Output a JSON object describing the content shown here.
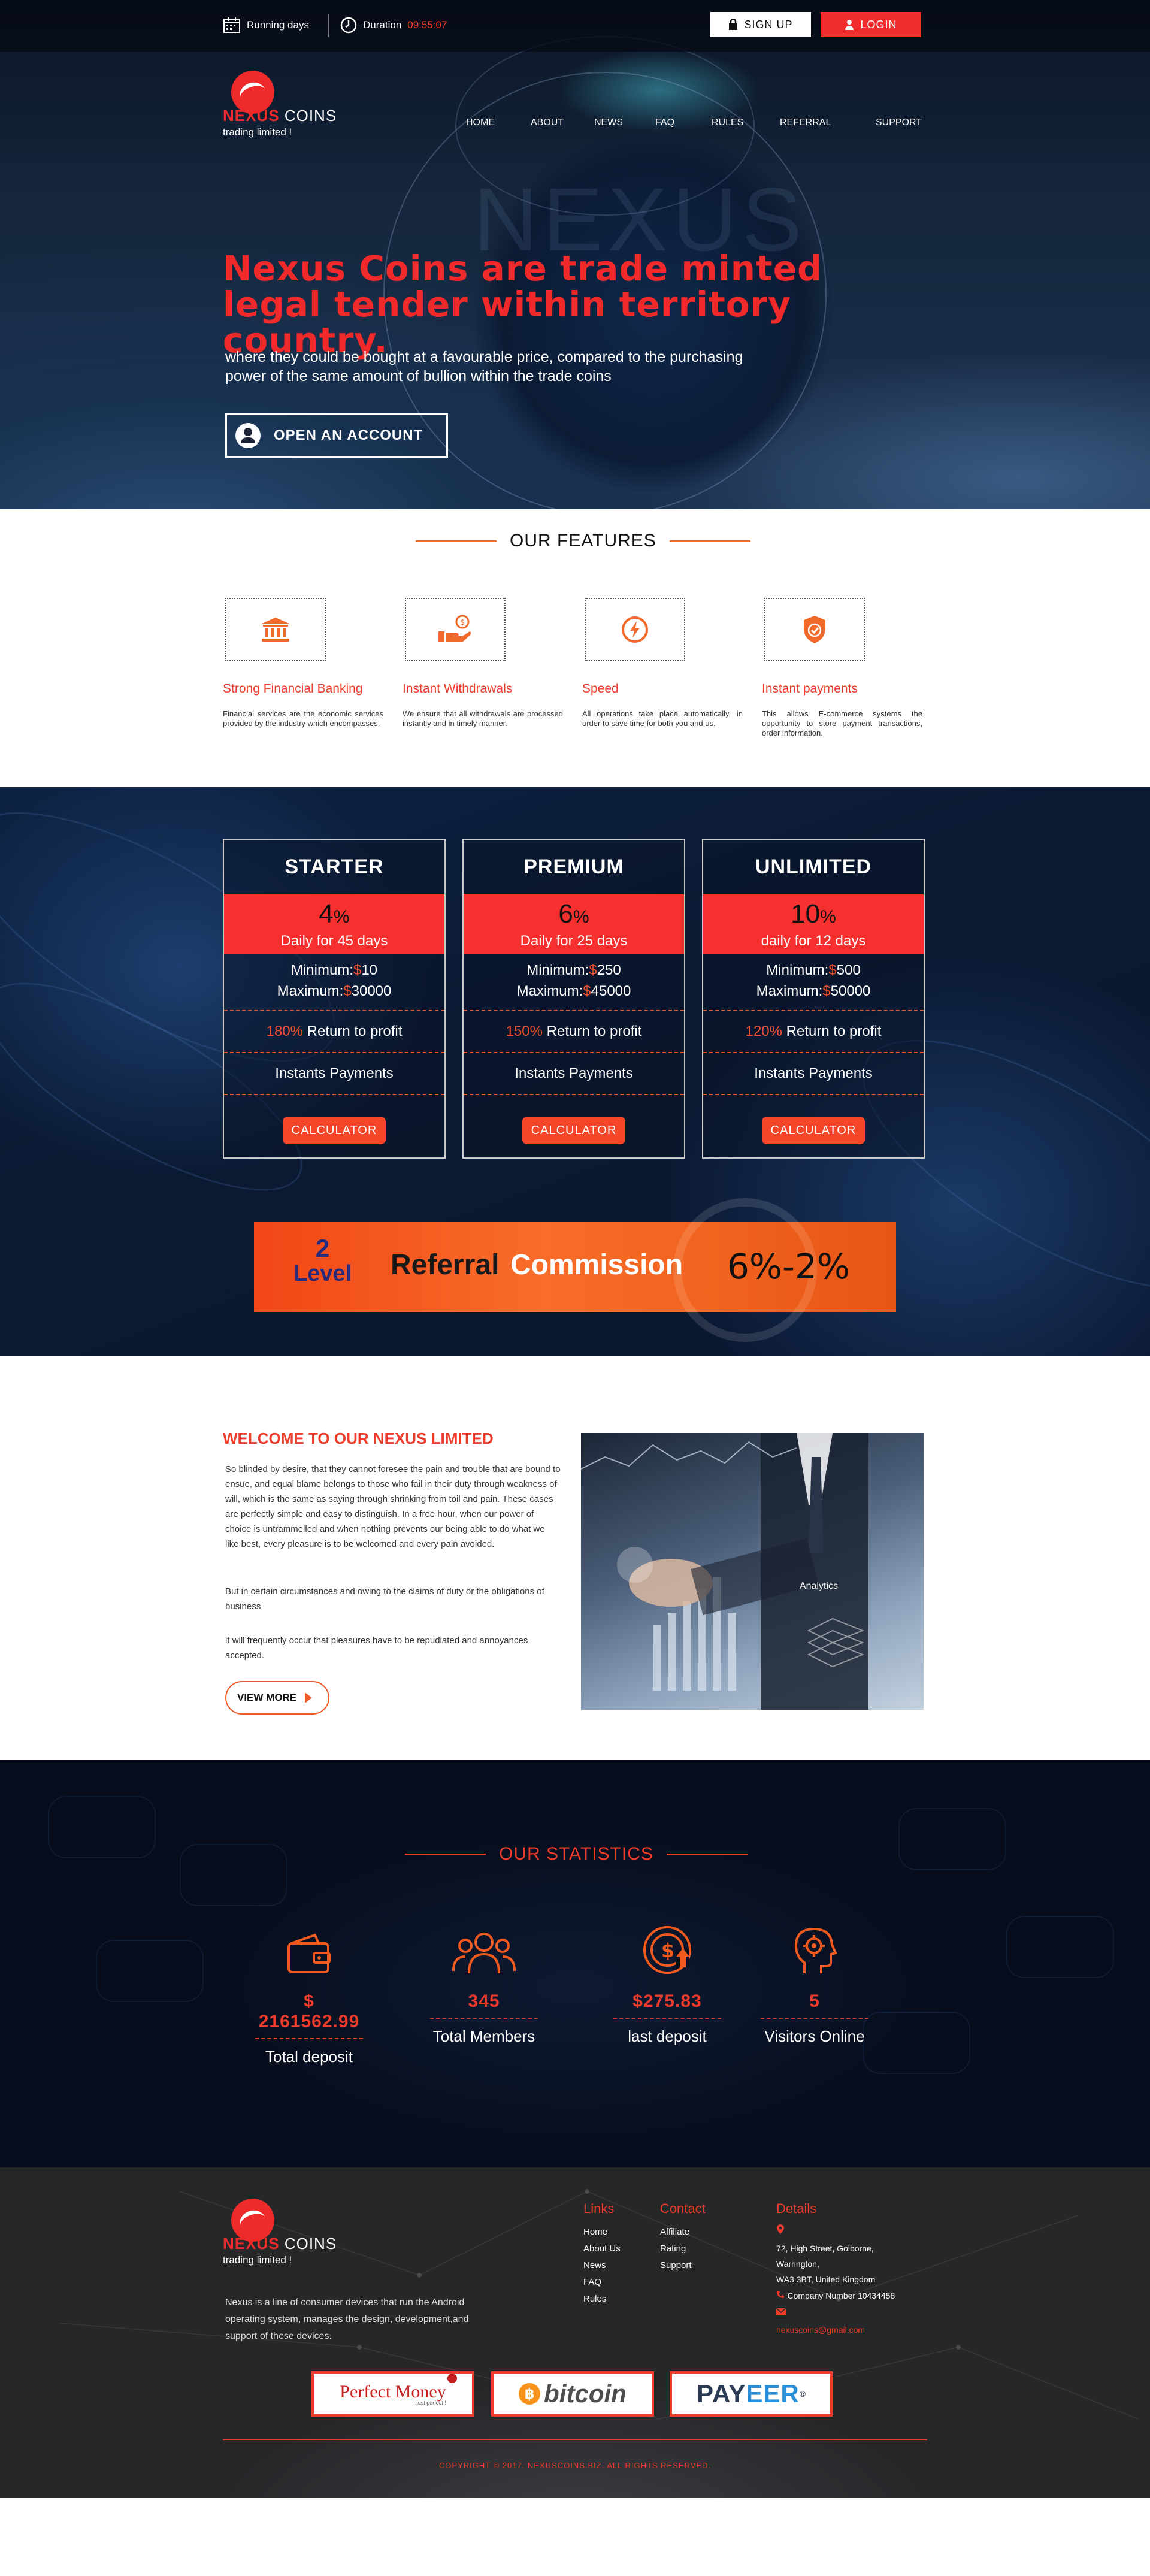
{
  "topbar": {
    "running_label": "Running days",
    "duration_label": "Duration",
    "duration_value": "09:55:07",
    "signup_label": "SIGN UP",
    "login_label": "LOGIN"
  },
  "brand": {
    "name_red": "NEXUS",
    "name_white": "COINS",
    "tagline": "trading limited !",
    "bg_word": "NEXUS"
  },
  "nav": [
    "HOME",
    "ABOUT",
    "NEWS",
    "FAQ",
    "RULES",
    "REFERRAL",
    "SUPPORT"
  ],
  "hero": {
    "title": "Nexus Coins are trade minted legal tender within territory country.",
    "text": "where they could be bought at a favourable price, compared to the purchasing power of the same amount of bullion within the trade coins",
    "button": "OPEN AN ACCOUNT"
  },
  "features": {
    "title": "OUR FEATURES",
    "items": [
      {
        "icon": "bank-icon",
        "title": "Strong Financial Banking",
        "text": "Financial services are the economic services provided by the industry which encompasses."
      },
      {
        "icon": "hand-coin-icon",
        "title": "Instant Withdrawals",
        "text": "We ensure that all withdrawals are processed instantly and in timely manner."
      },
      {
        "icon": "lightning-icon",
        "title": "Speed",
        "text": "All operations take place automatically, in order to save time for both you and us."
      },
      {
        "icon": "shield-check-icon",
        "title": "Instant payments",
        "text": "This allows E-commerce systems the opportunity to store payment transactions, order information."
      }
    ]
  },
  "plans": [
    {
      "name": "STARTER",
      "percent": "4",
      "sign": "%",
      "period": "Daily for 45 days",
      "min_label": "Minimum:",
      "cur": "$",
      "min": "10",
      "max_label": "Maximum:",
      "max": "30000",
      "return_pct": "180%",
      "return_text": "Return to profit",
      "payments": "Instants Payments",
      "button": "CALCULATOR"
    },
    {
      "name": "PREMIUM",
      "percent": "6",
      "sign": "%",
      "period": "Daily for 25 days",
      "min_label": "Minimum:",
      "cur": "$",
      "min": "250",
      "max_label": "Maximum:",
      "max": "45000",
      "return_pct": "150%",
      "return_text": "Return to profit",
      "payments": "Instants Payments",
      "button": "CALCULATOR"
    },
    {
      "name": "UNLIMITED",
      "percent": "10",
      "sign": "%",
      "period": "daily for 12 days",
      "min_label": "Minimum:",
      "cur": "$",
      "min": "500",
      "max_label": "Maximum:",
      "max": "50000",
      "return_pct": "120%",
      "return_text": "Return to profit",
      "payments": "Instants Payments",
      "button": "CALCULATOR"
    }
  ],
  "referral": {
    "level_num": "2",
    "level_word": "Level",
    "word1": "Referral",
    "word2": "Commission",
    "rates": "6%-2%"
  },
  "welcome": {
    "title": "WELCOME TO OUR NEXUS LIMITED",
    "p1": "So blinded by desire, that they cannot foresee the pain and trouble that are bound to ensue, and equal blame belongs to those who fail in their duty through weakness of will, which is the same as saying through shrinking from toil and pain. These cases are perfectly simple and easy to distinguish. In a free hour, when our power of choice is untrammelled and when nothing prevents our being able to do what we like best, every pleasure is to be welcomed and every pain avoided.",
    "p2": "But in certain circumstances and owing to the claims of duty or the obligations of business",
    "p3": "it will frequently occur that pleasures have to be repudiated and annoyances accepted.",
    "button": "VIEW MORE",
    "image_label": "Analytics"
  },
  "stats": {
    "title": "OUR STATISTICS",
    "items": [
      {
        "icon": "wallet-icon",
        "value": "$ 2161562.99",
        "label": "Total deposit"
      },
      {
        "icon": "members-icon",
        "value": "345",
        "label": "Total Members"
      },
      {
        "icon": "coin-deposit-icon",
        "value": "$275.83",
        "label": "last deposit"
      },
      {
        "icon": "head-gear-icon",
        "value": "5",
        "label": "Visitors Online"
      }
    ]
  },
  "footer": {
    "desc": "Nexus is a line of consumer devices that run the Android operating system, manages the design, development,and support of these devices.",
    "links_title": "Links",
    "links": [
      "Home",
      "About Us",
      "News",
      "FAQ",
      "Rules"
    ],
    "contact_title": "Contact",
    "contact": [
      "Affiliate",
      "Rating",
      "Support"
    ],
    "details_title": "Details",
    "address": [
      "72, High Street, Golborne,",
      "Warrington,",
      "WA3 3BT, United Kingdom"
    ],
    "company": "Company Number 10434458",
    "email": "nexuscoins@gmail.com",
    "payments": {
      "perfect_money": "Perfect Money",
      "perfect_money_sub": ".just perfect !",
      "bitcoin": "bitcoin",
      "payeer_a": "PAY",
      "payeer_b": "EER"
    },
    "copyright": "COPYRIGHT © 2017. NEXUSCOINS.BIZ. ALL RIGHTS RESERVED."
  },
  "colors": {
    "accent": "#f02a2a",
    "orange": "#f5502e",
    "dark": "#0b1a33"
  }
}
